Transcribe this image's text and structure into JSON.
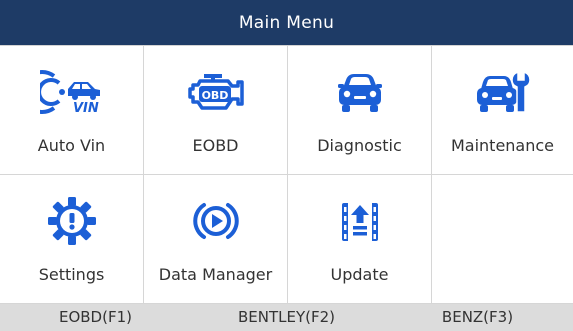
{
  "header": {
    "title": "Main Menu"
  },
  "menu": {
    "items": [
      {
        "label": "Auto Vin",
        "icon": "car-vin-icon"
      },
      {
        "label": "EOBD",
        "icon": "engine-obd-icon"
      },
      {
        "label": "Diagnostic",
        "icon": "car-front-icon"
      },
      {
        "label": "Maintenance",
        "icon": "car-wrench-icon"
      },
      {
        "label": "Settings",
        "icon": "gear-alert-icon"
      },
      {
        "label": "Data Manager",
        "icon": "play-circle-icon"
      },
      {
        "label": "Update",
        "icon": "upload-film-icon"
      },
      {
        "label": "",
        "icon": ""
      }
    ],
    "vin_badge": "VIN",
    "obd_badge": "OBD"
  },
  "function_keys": [
    {
      "label": "EOBD(F1)"
    },
    {
      "label": "BENTLEY(F2)"
    },
    {
      "label": "BENZ(F3)"
    }
  ],
  "colors": {
    "header_bg": "#1e3b66",
    "icon_blue": "#1c5fd6",
    "function_bar_bg": "#dcdcdc"
  }
}
